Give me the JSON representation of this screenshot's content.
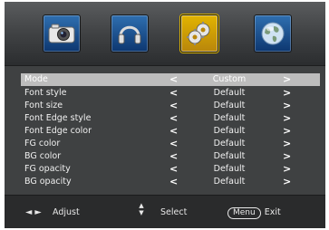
{
  "tabs": [
    {
      "icon": "camera-icon",
      "active": false
    },
    {
      "icon": "headphones-icon",
      "active": false
    },
    {
      "icon": "gear-icon",
      "active": true
    },
    {
      "icon": "globe-icon",
      "active": false
    }
  ],
  "menu": {
    "rows": [
      {
        "label": "Mode",
        "value": "Custom",
        "selected": true
      },
      {
        "label": "Font style",
        "value": "Default",
        "selected": false
      },
      {
        "label": "Font size",
        "value": "Default",
        "selected": false
      },
      {
        "label": "Font Edge style",
        "value": "Default",
        "selected": false
      },
      {
        "label": "Font Edge color",
        "value": "Default",
        "selected": false
      },
      {
        "label": "FG color",
        "value": "Default",
        "selected": false
      },
      {
        "label": "BG color",
        "value": "Default",
        "selected": false
      },
      {
        "label": "FG opacity",
        "value": "Default",
        "selected": false
      },
      {
        "label": "BG opacity",
        "value": "Default",
        "selected": false
      }
    ],
    "left_arrow": "<",
    "right_arrow": ">"
  },
  "footer": {
    "adjust_glyph": "◄ ►",
    "adjust_label": "Adjust",
    "select_glyph": "▲▼",
    "select_label": "Select",
    "menu_key": "Menu",
    "exit_label": "Exit"
  },
  "colors": {
    "panel": "#3f4142",
    "selected_row": "#bdbdbd",
    "active_tab": "#e2b400",
    "inactive_tab": "#1e5aa0"
  }
}
